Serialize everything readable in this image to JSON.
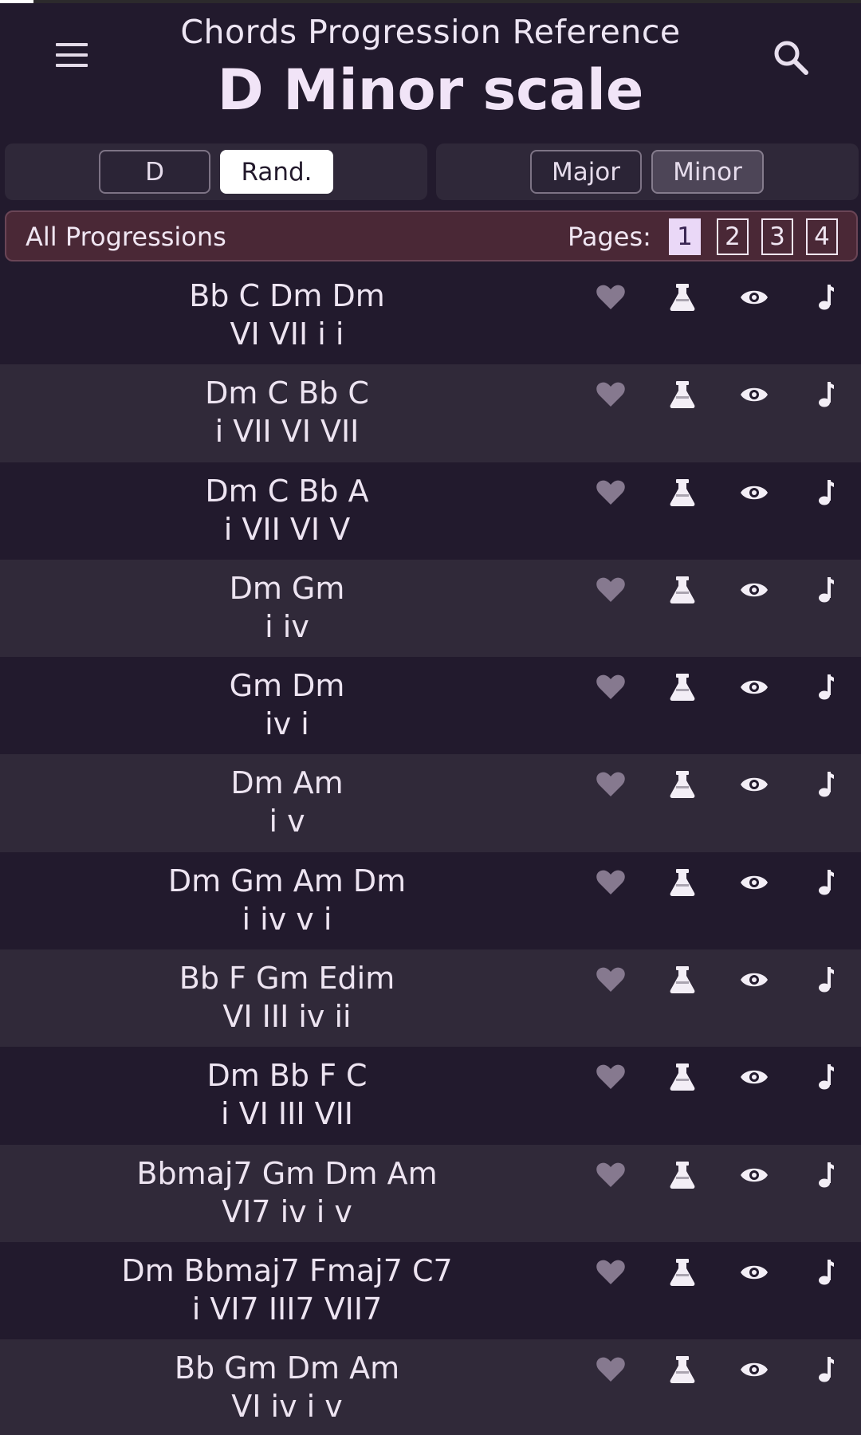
{
  "header": {
    "app_title": "Chords Progression Reference",
    "scale_title": "D Minor scale",
    "menu_icon": "hamburger-menu-icon",
    "search_icon": "search-icon"
  },
  "key_selector": {
    "key_label": "D",
    "random_label": "Rand.",
    "active": "Rand."
  },
  "mode_selector": {
    "major_label": "Major",
    "minor_label": "Minor",
    "selected": "Minor"
  },
  "progressions_bar": {
    "label": "All Progressions",
    "pages_label": "Pages:",
    "pages": [
      "1",
      "2",
      "3",
      "4"
    ],
    "current_page": "1"
  },
  "row_icons": [
    "heart-icon",
    "flask-icon",
    "eye-icon",
    "music-note-icon"
  ],
  "colors": {
    "background": "#221a2d",
    "row_alt": "#302939",
    "bar": "#4a2836",
    "heart": "#86798f",
    "icon": "#f3eef6"
  },
  "progressions": [
    {
      "chords": "Bb C Dm Dm",
      "numerals": "VI VII i i"
    },
    {
      "chords": "Dm C Bb C",
      "numerals": "i VII VI VII"
    },
    {
      "chords": "Dm C Bb A",
      "numerals": "i VII VI V"
    },
    {
      "chords": "Dm Gm",
      "numerals": "i iv"
    },
    {
      "chords": "Gm Dm",
      "numerals": "iv i"
    },
    {
      "chords": "Dm Am",
      "numerals": "i v"
    },
    {
      "chords": "Dm Gm Am Dm",
      "numerals": "i iv v i"
    },
    {
      "chords": "Bb F Gm Edim",
      "numerals": "VI III iv ii"
    },
    {
      "chords": "Dm Bb F C",
      "numerals": "i VI III VII"
    },
    {
      "chords": "Bbmaj7 Gm Dm Am",
      "numerals": "VI7 iv i v"
    },
    {
      "chords": "Dm Bbmaj7 Fmaj7 C7",
      "numerals": "i VI7 III7 VII7"
    },
    {
      "chords": "Bb Gm Dm Am",
      "numerals": "VI iv i v"
    }
  ]
}
